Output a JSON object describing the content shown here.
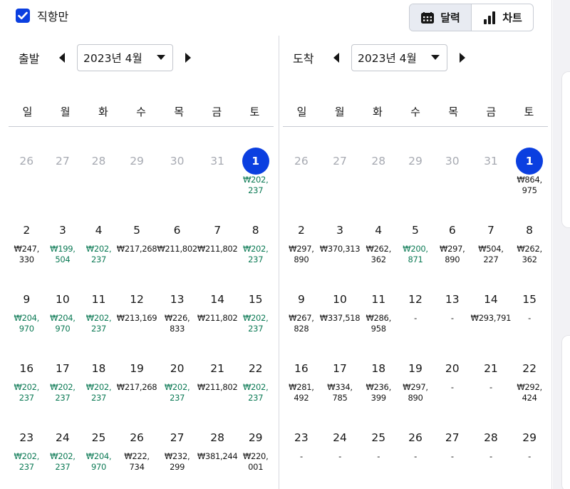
{
  "filter": {
    "direct_only_label": "직항만",
    "checked": true
  },
  "view_toggle": {
    "calendar_label": "달력",
    "chart_label": "차트",
    "active": "calendar"
  },
  "weekdays": [
    "일",
    "월",
    "화",
    "수",
    "목",
    "금",
    "토"
  ],
  "colors": {
    "accent": "#0b3fe0",
    "low_price": "#0c7a55",
    "muted": "#a7aab2"
  },
  "panels": [
    {
      "title": "출발",
      "month": "2023년 4월",
      "weeks": [
        [
          {
            "d": "26",
            "m": true
          },
          {
            "d": "27",
            "m": true
          },
          {
            "d": "28",
            "m": true
          },
          {
            "d": "29",
            "m": true
          },
          {
            "d": "30",
            "m": true
          },
          {
            "d": "31",
            "m": true
          },
          {
            "d": "1",
            "s": true,
            "p": [
              "₩202,",
              "237"
            ],
            "l": true
          }
        ],
        [
          {
            "d": "2",
            "p": [
              "₩247,",
              "330"
            ]
          },
          {
            "d": "3",
            "p": [
              "₩199,",
              "504"
            ],
            "l": true
          },
          {
            "d": "4",
            "p": [
              "₩202,",
              "237"
            ],
            "l": true
          },
          {
            "d": "5",
            "p": [
              "₩217,268"
            ]
          },
          {
            "d": "6",
            "p": [
              "₩211,802"
            ]
          },
          {
            "d": "7",
            "p": [
              "₩211,802"
            ]
          },
          {
            "d": "8",
            "p": [
              "₩202,",
              "237"
            ],
            "l": true
          }
        ],
        [
          {
            "d": "9",
            "p": [
              "₩204,",
              "970"
            ],
            "l": true
          },
          {
            "d": "10",
            "p": [
              "₩204,",
              "970"
            ],
            "l": true
          },
          {
            "d": "11",
            "p": [
              "₩202,",
              "237"
            ],
            "l": true
          },
          {
            "d": "12",
            "p": [
              "₩213,169"
            ]
          },
          {
            "d": "13",
            "p": [
              "₩226,",
              "833"
            ]
          },
          {
            "d": "14",
            "p": [
              "₩211,802"
            ]
          },
          {
            "d": "15",
            "p": [
              "₩202,",
              "237"
            ],
            "l": true
          }
        ],
        [
          {
            "d": "16",
            "p": [
              "₩202,",
              "237"
            ],
            "l": true
          },
          {
            "d": "17",
            "p": [
              "₩202,",
              "237"
            ],
            "l": true
          },
          {
            "d": "18",
            "p": [
              "₩202,",
              "237"
            ],
            "l": true
          },
          {
            "d": "19",
            "p": [
              "₩217,268"
            ]
          },
          {
            "d": "20",
            "p": [
              "₩202,",
              "237"
            ],
            "l": true
          },
          {
            "d": "21",
            "p": [
              "₩211,802"
            ]
          },
          {
            "d": "22",
            "p": [
              "₩202,",
              "237"
            ],
            "l": true
          }
        ],
        [
          {
            "d": "23",
            "p": [
              "₩202,",
              "237"
            ],
            "l": true
          },
          {
            "d": "24",
            "p": [
              "₩202,",
              "237"
            ],
            "l": true
          },
          {
            "d": "25",
            "p": [
              "₩204,",
              "970"
            ],
            "l": true
          },
          {
            "d": "26",
            "p": [
              "₩222,",
              "734"
            ]
          },
          {
            "d": "27",
            "p": [
              "₩232,",
              "299"
            ]
          },
          {
            "d": "28",
            "p": [
              "₩381,244"
            ]
          },
          {
            "d": "29",
            "p": [
              "₩220,",
              "001"
            ]
          }
        ]
      ]
    },
    {
      "title": "도착",
      "month": "2023년 4월",
      "weeks": [
        [
          {
            "d": "26",
            "m": true
          },
          {
            "d": "27",
            "m": true
          },
          {
            "d": "28",
            "m": true
          },
          {
            "d": "29",
            "m": true
          },
          {
            "d": "30",
            "m": true
          },
          {
            "d": "31",
            "m": true
          },
          {
            "d": "1",
            "s": true,
            "p": [
              "₩864,",
              "975"
            ]
          }
        ],
        [
          {
            "d": "2",
            "p": [
              "₩297,",
              "890"
            ]
          },
          {
            "d": "3",
            "p": [
              "₩370,313"
            ]
          },
          {
            "d": "4",
            "p": [
              "₩262,",
              "362"
            ]
          },
          {
            "d": "5",
            "p": [
              "₩200,",
              "871"
            ],
            "l": true
          },
          {
            "d": "6",
            "p": [
              "₩297,",
              "890"
            ]
          },
          {
            "d": "7",
            "p": [
              "₩504,",
              "227"
            ]
          },
          {
            "d": "8",
            "p": [
              "₩262,",
              "362"
            ]
          }
        ],
        [
          {
            "d": "9",
            "p": [
              "₩267,",
              "828"
            ]
          },
          {
            "d": "10",
            "p": [
              "₩337,518"
            ]
          },
          {
            "d": "11",
            "p": [
              "₩286,",
              "958"
            ]
          },
          {
            "d": "12",
            "p": [
              "-"
            ]
          },
          {
            "d": "13",
            "p": [
              "-"
            ]
          },
          {
            "d": "14",
            "p": [
              "₩293,791"
            ]
          },
          {
            "d": "15",
            "p": [
              "-"
            ]
          }
        ],
        [
          {
            "d": "16",
            "p": [
              "₩281,",
              "492"
            ]
          },
          {
            "d": "17",
            "p": [
              "₩334,",
              "785"
            ]
          },
          {
            "d": "18",
            "p": [
              "₩236,",
              "399"
            ]
          },
          {
            "d": "19",
            "p": [
              "₩297,",
              "890"
            ]
          },
          {
            "d": "20",
            "p": [
              "-"
            ]
          },
          {
            "d": "21",
            "p": [
              "-"
            ]
          },
          {
            "d": "22",
            "p": [
              "₩292,",
              "424"
            ]
          }
        ],
        [
          {
            "d": "23",
            "p": [
              "-"
            ]
          },
          {
            "d": "24",
            "p": [
              "-"
            ]
          },
          {
            "d": "25",
            "p": [
              "-"
            ]
          },
          {
            "d": "26",
            "p": [
              "-"
            ]
          },
          {
            "d": "27",
            "p": [
              "-"
            ]
          },
          {
            "d": "28",
            "p": [
              "-"
            ]
          },
          {
            "d": "29",
            "p": [
              "-"
            ]
          }
        ]
      ]
    }
  ]
}
